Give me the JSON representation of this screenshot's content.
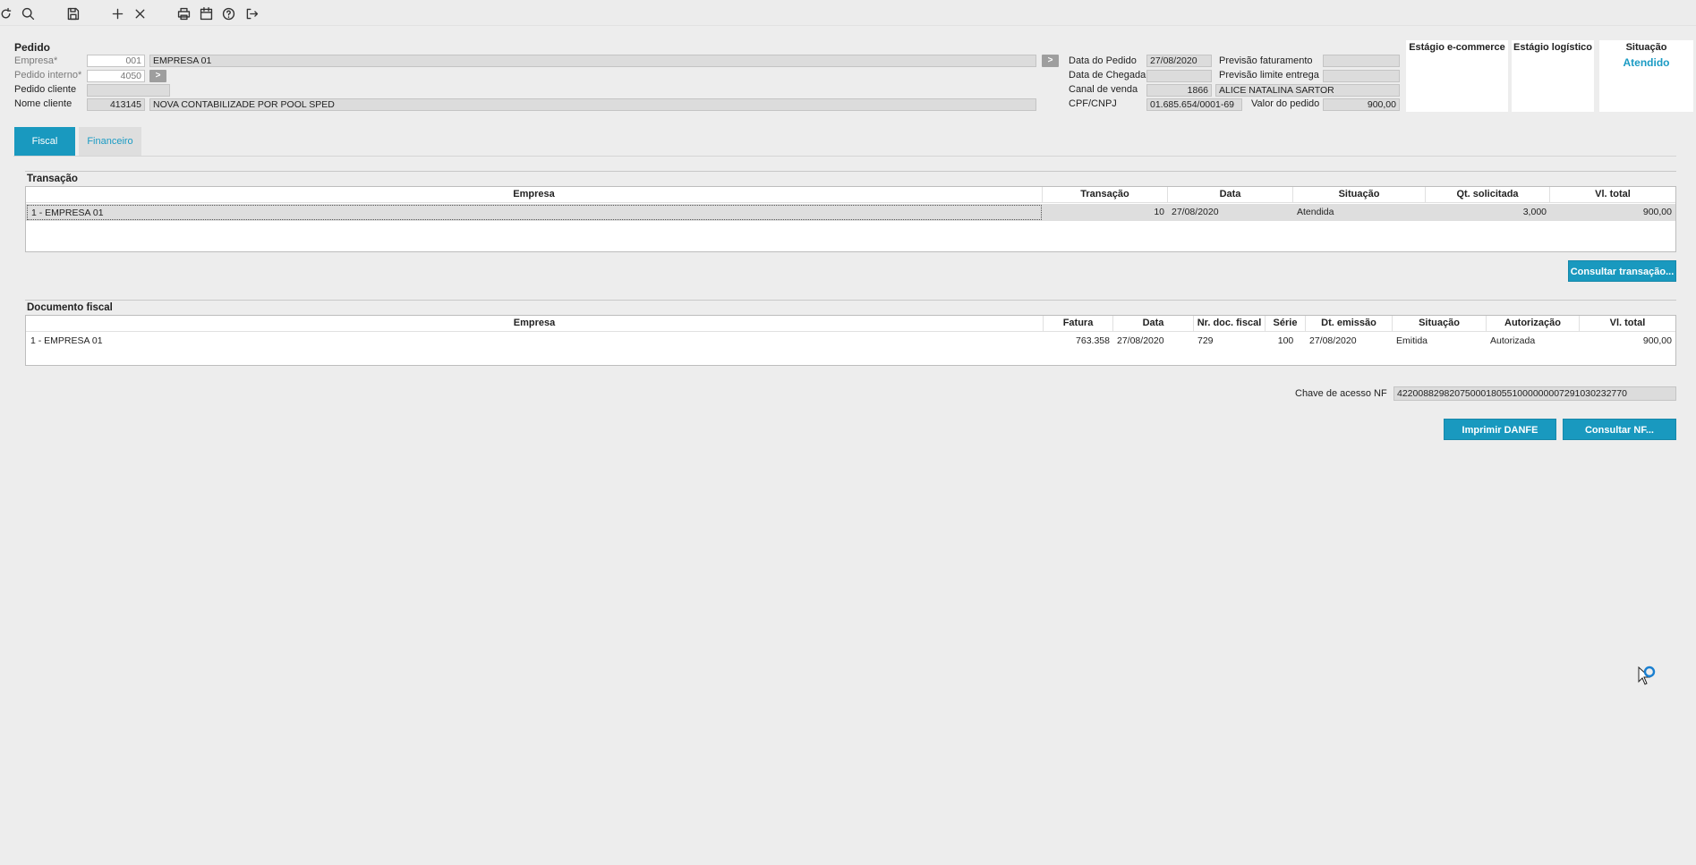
{
  "toolbar": {
    "icons": [
      "refresh-icon",
      "search-icon",
      "save-icon",
      "add-icon",
      "close-icon",
      "print-icon",
      "calendar-icon",
      "help-icon",
      "exit-icon"
    ]
  },
  "pedido": {
    "section_title": "Pedido",
    "empresa_label": "Empresa*",
    "empresa_code": "001",
    "empresa_name": "EMPRESA 01",
    "pedido_interno_label": "Pedido interno*",
    "pedido_interno_value": "4050",
    "pedido_cliente_label": "Pedido cliente",
    "pedido_cliente_value": "",
    "nome_cliente_label": "Nome cliente",
    "nome_cliente_code": "413145",
    "nome_cliente_name": "NOVA CONTABILIZADE POR POOL SPED",
    "data_pedido_label": "Data do Pedido",
    "data_pedido_value": "27/08/2020",
    "data_chegada_label": "Data de Chegada",
    "data_chegada_value": "",
    "canal_venda_label": "Canal de venda",
    "canal_venda_code": "1866",
    "canal_venda_name": "ALICE NATALINA SARTOR",
    "cpf_cnpj_label": "CPF/CNPJ",
    "cpf_cnpj_value": "01.685.654/0001-69",
    "previsao_faturamento_label": "Previsão faturamento",
    "previsao_faturamento_value": "",
    "previsao_limite_label": "Previsão limite entrega",
    "previsao_limite_value": "",
    "valor_pedido_label": "Valor do pedido",
    "valor_pedido_value": "900,00"
  },
  "stages": {
    "ecommerce_title": "Estágio e-commerce",
    "logistico_title": "Estágio logístico",
    "situacao_title": "Situação",
    "situacao_value": "Atendido",
    "accent_color": "#1a9bc4"
  },
  "tabs": [
    {
      "label": "Fiscal",
      "active": true
    },
    {
      "label": "Financeiro",
      "active": false
    }
  ],
  "transacao": {
    "title": "Transação",
    "columns": [
      "Empresa",
      "Transação",
      "Data",
      "Situação",
      "Qt. solicitada",
      "Vl. total"
    ],
    "rows": [
      [
        "1 - EMPRESA 01",
        "10",
        "27/08/2020",
        "Atendida",
        "3,000",
        "900,00"
      ]
    ],
    "consultar_button": "Consultar transação..."
  },
  "documento": {
    "title": "Documento fiscal",
    "columns": [
      "Empresa",
      "Fatura",
      "Data",
      "Nr. doc. fiscal",
      "Série",
      "Dt. emissão",
      "Situação",
      "Autorização",
      "Vl. total"
    ],
    "rows": [
      [
        "1 - EMPRESA 01",
        "763.358",
        "27/08/2020",
        "729",
        "100",
        "27/08/2020",
        "Emitida",
        "Autorizada",
        "900,00"
      ]
    ],
    "chave_label": "Chave de acesso NF",
    "chave_value": "42200882982075000180551000000007291030232770",
    "imprimir_button": "Imprimir DANFE",
    "consultar_nf_button": "Consultar NF..."
  },
  "colors": {
    "primary": "#1999bf",
    "background": "#ededed"
  }
}
